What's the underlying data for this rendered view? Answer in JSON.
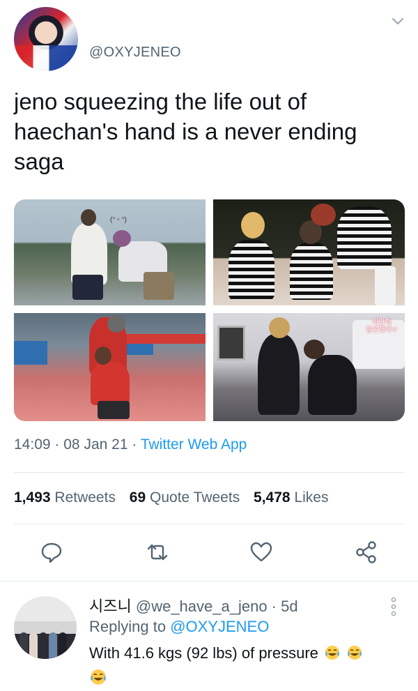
{
  "tweet": {
    "handle": "@OXYJENEO",
    "text": "jeno squeezing the life out of haechan's hand is a never ending saga",
    "image_captions": {
      "top_left": "(ᐢ ᵕ ᐢ)",
      "bottom_right_line1": "미안해",
      "bottom_right_line2": "잘못했어ㅠ"
    },
    "time": "14:09",
    "date": "08 Jan 21",
    "separator": "·",
    "app": "Twitter Web App",
    "stats": {
      "retweets_count": "1,493",
      "retweets_label": "Retweets",
      "quotes_count": "69",
      "quotes_label": "Quote Tweets",
      "likes_count": "5,478",
      "likes_label": "Likes"
    }
  },
  "actions": {
    "reply_icon": "reply-bubble-icon",
    "retweet_icon": "retweet-icon",
    "like_icon": "heart-icon",
    "share_icon": "share-icon"
  },
  "reply": {
    "name": "시즈니",
    "handle": "@we_have_a_jeno",
    "separator": "·",
    "age": "5d",
    "replying_prefix": "Replying to",
    "replying_to": "@OXYJENEO",
    "text": "With 41.6 kgs (92 lbs) of pressure",
    "emoji": "face-with-tears-of-joy"
  },
  "colors": {
    "accent": "#1d9bf0",
    "secondary_text": "#536471",
    "primary_text": "#0f1419",
    "divider": "#e3e7ea"
  }
}
